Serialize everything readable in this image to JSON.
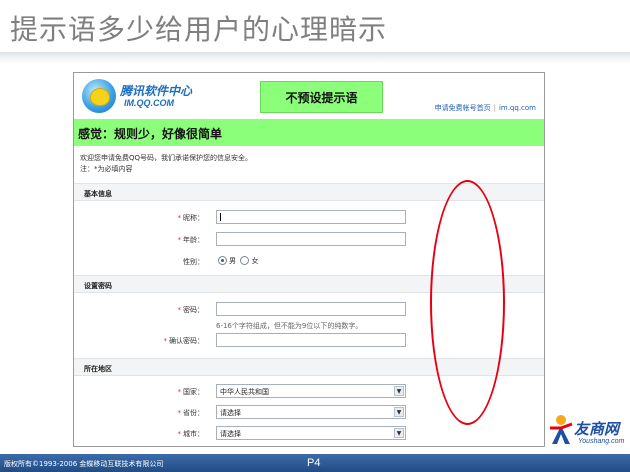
{
  "slide": {
    "title": "提示语多少给用户的心理暗示",
    "page": "P4",
    "copyright": "版权所有©1993-2006 金蝶移动互联技术有限公司"
  },
  "brand": {
    "name_cn": "友商网",
    "name_en": "Youshang.com"
  },
  "screenshot": {
    "logo_cn": "腾讯软件中心",
    "logo_en": "IM.QQ.COM",
    "callout_top": "不预设提示语",
    "callout_feeling": "感觉：规则少，好像很简单",
    "links": {
      "apply": "申请免费帐号首页",
      "separator": "|",
      "site": "im.qq.com"
    },
    "welcome": "欢迎您申请免费QQ号码，我们承诺保护您的信息安全。",
    "required_note": "注：*为必填内容",
    "sections": {
      "basic": "基本信息",
      "password": "设置密码",
      "region": "所在地区"
    },
    "fields": {
      "nickname_label": "昵称：",
      "nickname_value": "",
      "age_label": "年龄：",
      "age_value": "",
      "gender_label": "性别：",
      "gender_male": "男",
      "gender_female": "女",
      "gender_selected": "male",
      "password_label": "密码：",
      "password_value": "",
      "password_hint": "6-16个字符组成，但不能为9位以下的纯数字。",
      "confirm_label": "确认密码：",
      "confirm_value": "",
      "country_label": "国家：",
      "country_value": "中华人民共和国",
      "province_label": "省份：",
      "province_value": "请选择",
      "city_label": "城市：",
      "city_value": "请选择"
    }
  },
  "colors": {
    "callout": "#8bff79",
    "annotation": "#e60012",
    "footer": "#2c5a96",
    "title": "#7f7f7f"
  }
}
